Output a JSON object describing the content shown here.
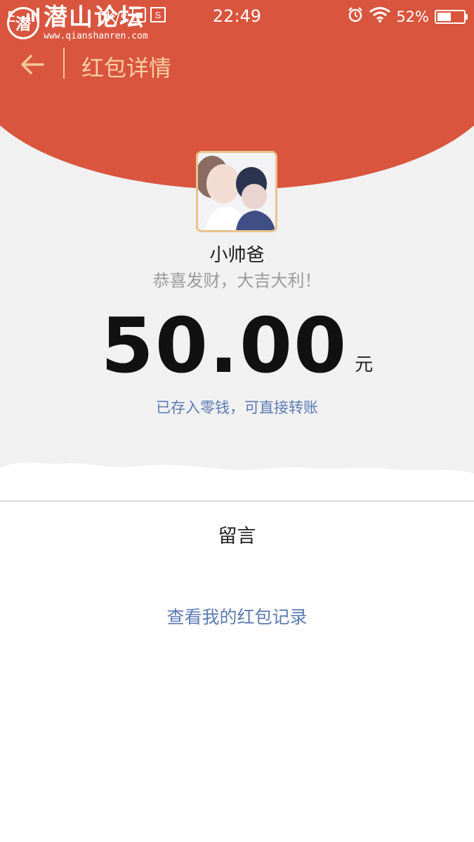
{
  "status_bar": {
    "network_left": "E",
    "data_speed": "0K/s",
    "time": "22:49",
    "battery_percent": "52%",
    "battery_level": 0.52,
    "icons": [
      "signal-icon",
      "sim-icon",
      "screenshot-icon",
      "alarm-icon",
      "wifi-icon",
      "battery-icon"
    ]
  },
  "watermark": {
    "title": "潜山论坛",
    "url": "www.qianshanren.com"
  },
  "nav": {
    "back_icon": "back-arrow-icon",
    "title": "红包详情"
  },
  "colors": {
    "header_red": "#d9553e",
    "nav_text": "#f6cfa3",
    "link_blue": "#5b7bb3",
    "avatar_border": "#e9c38c",
    "background_gray": "#f1f1f1"
  },
  "packet": {
    "sender_name": "小帅爸",
    "greeting": "恭喜发财，大吉大利！",
    "amount": "50.00",
    "unit": "元",
    "status": "已存入零钱，可直接转账"
  },
  "message": {
    "label": "留言"
  },
  "records_link": "查看我的红包记录"
}
